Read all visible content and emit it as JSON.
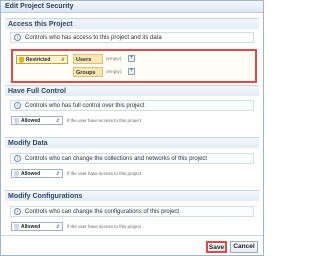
{
  "dialog": {
    "title": "Edit Project Security"
  },
  "sections": [
    {
      "title": "Access this Project",
      "info": "Controls who has access to this project and its data",
      "selector": "Restricted",
      "acl": [
        {
          "label": "Users",
          "value": "(empty)"
        },
        {
          "label": "Groups",
          "value": "(empty)"
        }
      ]
    },
    {
      "title": "Have Full Control",
      "info": "Controls who has full control over this project",
      "selector": "Allowed",
      "hint": "if the user have access to this project"
    },
    {
      "title": "Modify Data",
      "info": "Controls who can change the collections and networks of this project",
      "selector": "Allowed",
      "hint": "if the user have access to this project"
    },
    {
      "title": "Modify Configurations",
      "info": "Controls who can change the configurations of this project",
      "selector": "Allowed",
      "hint": "if the user have access to this project"
    }
  ],
  "footer": {
    "save_label": "Save",
    "cancel_label": "Cancel"
  },
  "colors": {
    "highlight": "#e24a4a",
    "header_text": "#2d4565"
  }
}
